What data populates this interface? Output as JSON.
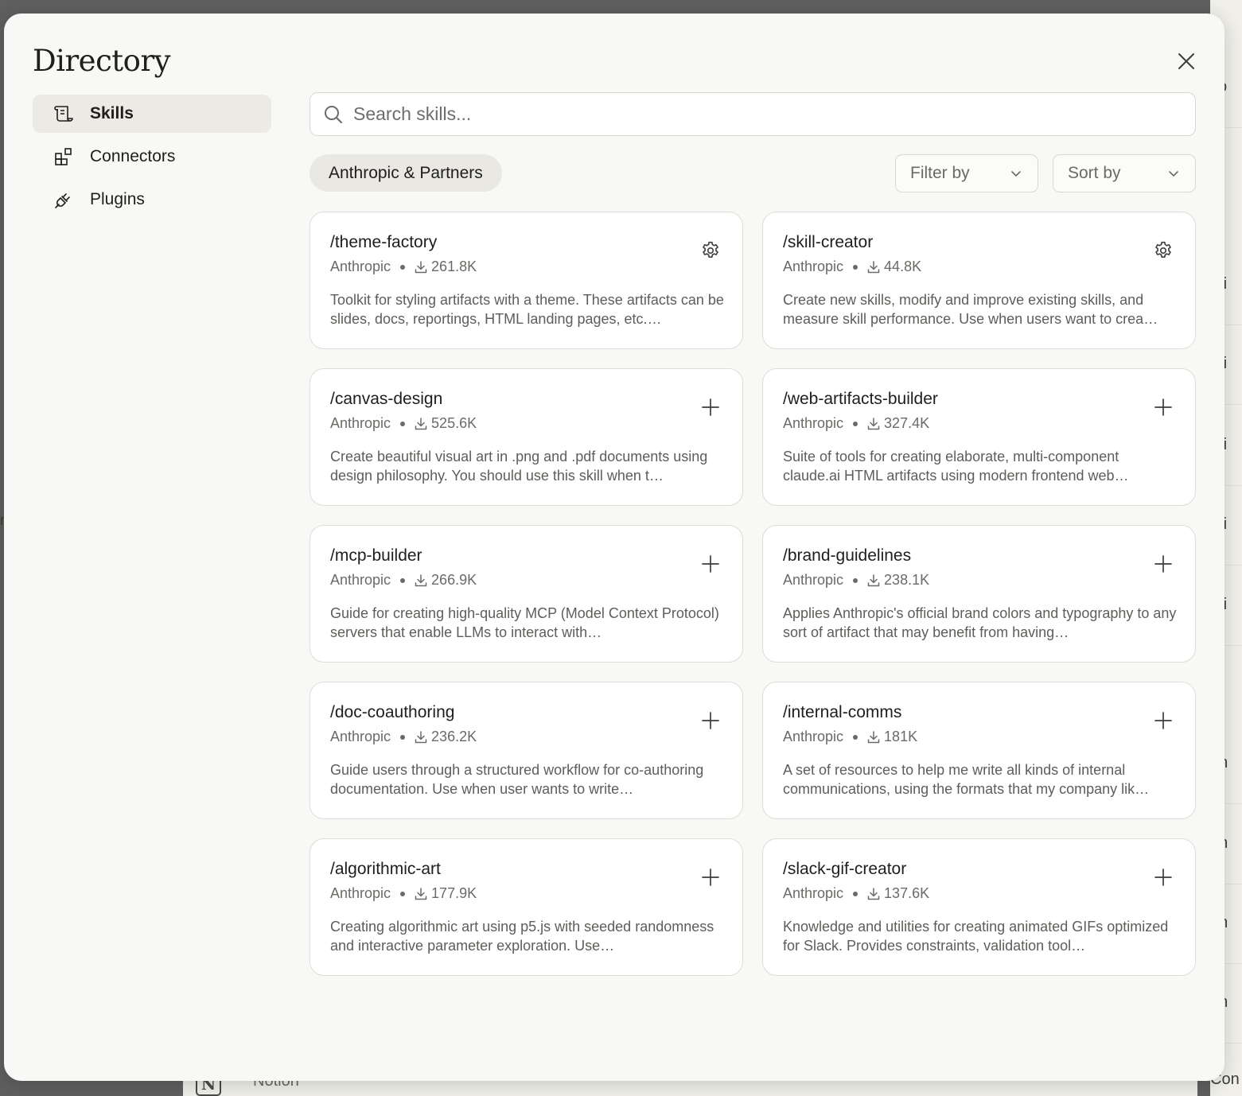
{
  "background": {
    "right_fragments": [
      "co",
      "nfi",
      "nfi",
      "nfi",
      "nfi",
      "nfi",
      "on",
      "on",
      "on",
      "on",
      "Con"
    ],
    "left_fragment": "r",
    "bottom_app_name": "Notion",
    "bottom_app_icon": "N"
  },
  "modal": {
    "title": "Directory",
    "close_icon": "close-icon"
  },
  "sidebar": {
    "items": [
      {
        "label": "Skills",
        "icon": "skills-scroll-icon",
        "active": true
      },
      {
        "label": "Connectors",
        "icon": "connectors-blocks-icon",
        "active": false
      },
      {
        "label": "Plugins",
        "icon": "plugin-plug-icon",
        "active": false
      }
    ]
  },
  "search": {
    "placeholder": "Search skills...",
    "value": ""
  },
  "filters": {
    "source_pill": "Anthropic & Partners",
    "filter_by": "Filter by",
    "sort_by": "Sort by"
  },
  "skills": [
    {
      "name": "/theme-factory",
      "author": "Anthropic",
      "downloads": "261.8K",
      "action": "settings",
      "description": "Toolkit for styling artifacts with a theme. These artifacts can be slides, docs, reportings, HTML landing pages, etc.…"
    },
    {
      "name": "/skill-creator",
      "author": "Anthropic",
      "downloads": "44.8K",
      "action": "settings",
      "description": "Create new skills, modify and improve existing skills, and measure skill performance. Use when users want to crea…"
    },
    {
      "name": "/canvas-design",
      "author": "Anthropic",
      "downloads": "525.6K",
      "action": "add",
      "description": "Create beautiful visual art in .png and .pdf documents using design philosophy. You should use this skill when t…"
    },
    {
      "name": "/web-artifacts-builder",
      "author": "Anthropic",
      "downloads": "327.4K",
      "action": "add",
      "description": "Suite of tools for creating elaborate, multi-component claude.ai HTML artifacts using modern frontend web…"
    },
    {
      "name": "/mcp-builder",
      "author": "Anthropic",
      "downloads": "266.9K",
      "action": "add",
      "description": "Guide for creating high-quality MCP (Model Context Protocol) servers that enable LLMs to interact with…"
    },
    {
      "name": "/brand-guidelines",
      "author": "Anthropic",
      "downloads": "238.1K",
      "action": "add",
      "description": "Applies Anthropic's official brand colors and typography to any sort of artifact that may benefit from having…"
    },
    {
      "name": "/doc-coauthoring",
      "author": "Anthropic",
      "downloads": "236.2K",
      "action": "add",
      "description": "Guide users through a structured workflow for co-authoring documentation. Use when user wants to write…"
    },
    {
      "name": "/internal-comms",
      "author": "Anthropic",
      "downloads": "181K",
      "action": "add",
      "description": "A set of resources to help me write all kinds of internal communications, using the formats that my company lik…"
    },
    {
      "name": "/algorithmic-art",
      "author": "Anthropic",
      "downloads": "177.9K",
      "action": "add",
      "description": "Creating algorithmic art using p5.js with seeded randomness and interactive parameter exploration. Use…"
    },
    {
      "name": "/slack-gif-creator",
      "author": "Anthropic",
      "downloads": "137.6K",
      "action": "add",
      "description": "Knowledge and utilities for creating animated GIFs optimized for Slack. Provides constraints, validation tool…"
    }
  ],
  "colors": {
    "overlay": "#5f5f5f",
    "modal_bg": "#f8f8f6",
    "card_bg": "#ffffff",
    "active_nav_bg": "#ebeae5",
    "pill_bg": "#e9e8e2",
    "text_primary": "#1f1e1d",
    "text_secondary": "#6b6a66"
  }
}
